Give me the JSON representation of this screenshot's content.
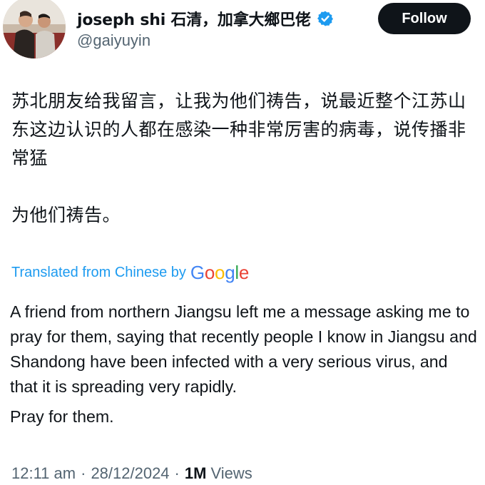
{
  "author": {
    "display_name": "joseph shi 石清，加拿大鄉巴佬",
    "handle": "@gaiyuyin",
    "verified_icon": "verified-badge-icon",
    "avatar_icon": "profile-photo"
  },
  "follow_button": {
    "label": "Follow"
  },
  "original_text": {
    "paragraphs": [
      "苏北朋友给我留言，让我为他们祷告，说最近整个江苏山东这边认识的人都在感染一种非常厉害的病毒，说传播非常猛",
      "为他们祷告。"
    ]
  },
  "translation": {
    "label": "Translated from Chinese by",
    "provider_letters": [
      "G",
      "o",
      "o",
      "g",
      "l",
      "e"
    ],
    "paragraphs": [
      "A friend from northern Jiangsu left me a message asking me to pray for them, saying that recently people I know in Jiangsu and Shandong have been infected with a very serious virus, and that it is spreading very rapidly.",
      "Pray for them."
    ]
  },
  "meta": {
    "time": "12:11 am",
    "separator": "·",
    "date": "28/12/2024",
    "views_count": "1M",
    "views_label": "Views"
  },
  "colors": {
    "accent": "#1d9bf0",
    "text_primary": "#0f1419",
    "text_secondary": "#536471",
    "follow_bg": "#0f1419",
    "google": [
      "#4285F4",
      "#EA4335",
      "#FBBC05",
      "#4285F4",
      "#34A853",
      "#EA4335"
    ]
  }
}
